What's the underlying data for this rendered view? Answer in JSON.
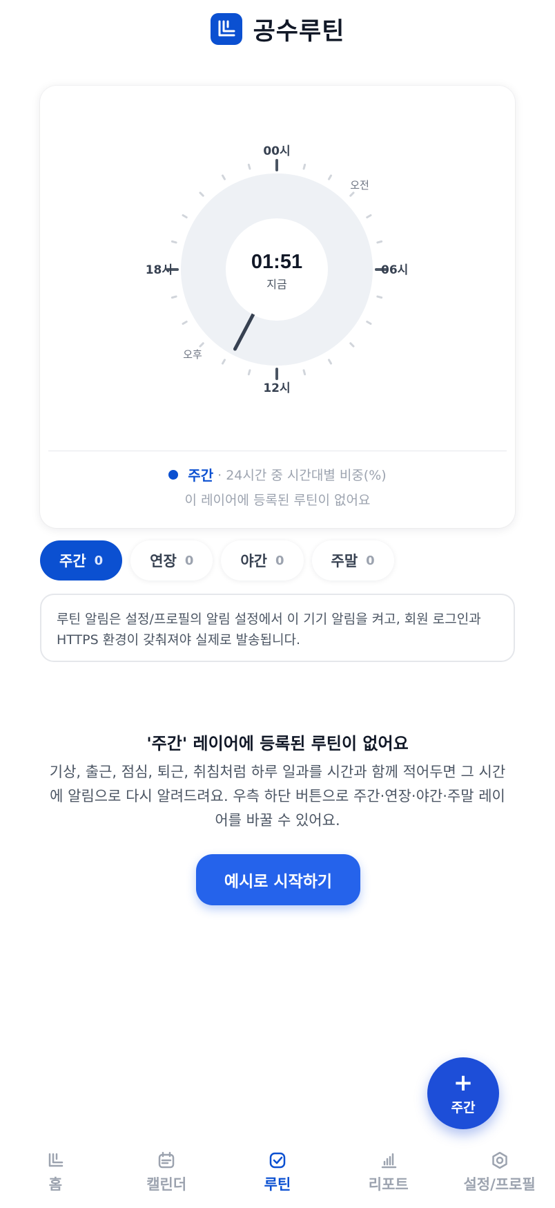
{
  "header": {
    "title": "공수루틴",
    "logo_icon": "routine-logo-icon"
  },
  "clock": {
    "time": "01:51",
    "time_label": "지금",
    "hour_labels": {
      "top": "00시",
      "right": "06시",
      "bottom": "12시",
      "left": "18시"
    },
    "period_labels": {
      "am": "오전",
      "pm": "오후"
    }
  },
  "legend": {
    "layer_name": "주간",
    "description": "· 24시간 중 시간대별 비중(%)",
    "empty_text": "이 레이어에 등록된 루틴이 없어요",
    "color": "#0b50d1"
  },
  "tabs": [
    {
      "label": "주간",
      "count": "0",
      "active": true
    },
    {
      "label": "연장",
      "count": "0",
      "active": false
    },
    {
      "label": "야간",
      "count": "0",
      "active": false
    },
    {
      "label": "주말",
      "count": "0",
      "active": false
    }
  ],
  "notice": {
    "text": "루틴 알림은 설정/프로필의 알림 설정에서 이 기기 알림을 켜고, 회원 로그인과 HTTPS 환경이 갖춰져야 실제로 발송됩니다."
  },
  "empty_state": {
    "title": "'주간' 레이어에 등록된 루틴이 없어요",
    "description": "기상, 출근, 점심, 퇴근, 취침처럼 하루 일과를 시간과 함께 적어두면 그 시간에 알림으로 다시 알려드려요. 우측 하단 버튼으로 주간·연장·야간·주말 레이어를 바꿀 수 있어요.",
    "button_label": "예시로 시작하기"
  },
  "fab": {
    "plus": "+",
    "label": "주간"
  },
  "nav": [
    {
      "label": "홈",
      "icon": "home-icon",
      "active": false
    },
    {
      "label": "캘린더",
      "icon": "calendar-icon",
      "active": false
    },
    {
      "label": "루틴",
      "icon": "routine-icon",
      "active": true
    },
    {
      "label": "리포트",
      "icon": "chart-icon",
      "active": false
    },
    {
      "label": "설정/프로필",
      "icon": "gear-icon",
      "active": false
    }
  ],
  "colors": {
    "accent": "#0b50d1",
    "button": "#2563eb",
    "dial": "#eef1f5"
  }
}
